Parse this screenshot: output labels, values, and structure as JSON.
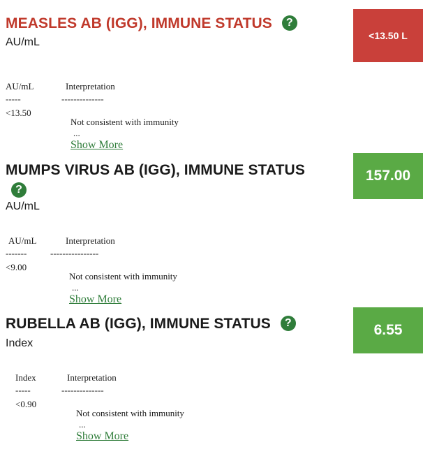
{
  "colors": {
    "high_low": "#c9403a",
    "normal": "#5aaa45",
    "title_red": "#c0392b",
    "title_dark": "#1a1a1a",
    "help": "#2f7d3a"
  },
  "help_icon": "question-circle-icon",
  "tests": [
    {
      "title": "MEASLES AB (IGG), IMMUNE STATUS",
      "unit": "AU/mL",
      "result": "<13.50 L",
      "ref_header_unit": "AU/mL",
      "ref_header_interp": "Interpretation",
      "ref_dash_unit": "-----",
      "ref_dash_interp": "--------------",
      "ref_value": "<13.50",
      "ref_interp": "Not consistent with immunity",
      "ellipsis": "...",
      "show_more": "Show More"
    },
    {
      "title": "MUMPS VIRUS AB (IGG), IMMUNE STATUS",
      "unit": "AU/mL",
      "result": "157.00",
      "ref_header_unit": "AU/mL",
      "ref_header_interp": "Interpretation",
      "ref_dash_unit": "-------",
      "ref_dash_interp": "----------------",
      "ref_value": "<9.00",
      "ref_interp": "Not consistent with immunity",
      "ellipsis": "...",
      "show_more": "Show More"
    },
    {
      "title": "RUBELLA AB (IGG), IMMUNE STATUS",
      "unit": "Index",
      "result": "6.55",
      "ref_header_unit": "Index",
      "ref_header_interp": "Interpretation",
      "ref_dash_unit": "-----",
      "ref_dash_interp": "--------------",
      "ref_value": "<0.90",
      "ref_interp": "Not consistent with immunity",
      "ellipsis": "...",
      "show_more": "Show More"
    }
  ]
}
